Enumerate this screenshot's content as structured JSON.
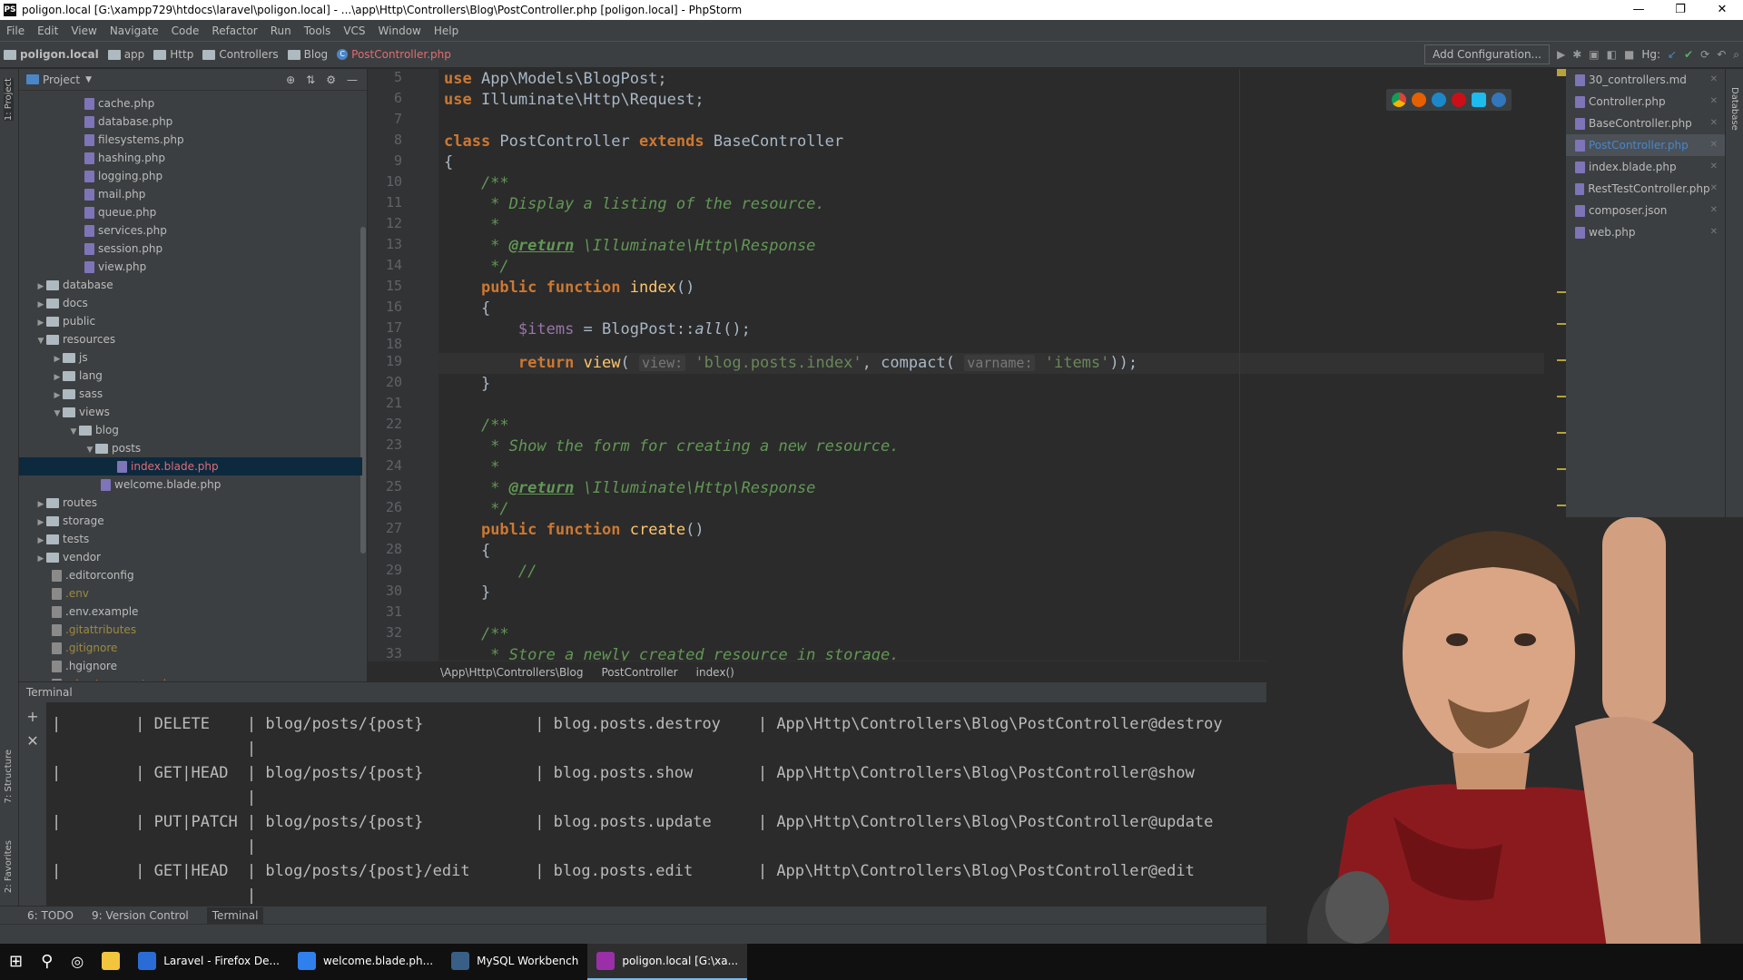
{
  "window": {
    "title": "poligon.local [G:\\xampp729\\htdocs\\laravel\\poligon.local] - ...\\app\\Http\\Controllers\\Blog\\PostController.php [poligon.local] - PhpStorm",
    "minimize": "—",
    "restore": "❐",
    "close": "✕"
  },
  "menu": [
    "File",
    "Edit",
    "View",
    "Navigate",
    "Code",
    "Refactor",
    "Run",
    "Tools",
    "VCS",
    "Window",
    "Help"
  ],
  "breadcrumbs": [
    "poligon.local",
    "app",
    "Http",
    "Controllers",
    "Blog",
    "PostController.php"
  ],
  "toolbar": {
    "add_configuration": "Add Configuration...",
    "hg_label": "Hg:"
  },
  "project_panel": {
    "title": "Project",
    "items": [
      {
        "label": "cache.php",
        "type": "file",
        "indent": 4
      },
      {
        "label": "database.php",
        "type": "file",
        "indent": 4
      },
      {
        "label": "filesystems.php",
        "type": "file",
        "indent": 4
      },
      {
        "label": "hashing.php",
        "type": "file",
        "indent": 4
      },
      {
        "label": "logging.php",
        "type": "file",
        "indent": 4
      },
      {
        "label": "mail.php",
        "type": "file",
        "indent": 4
      },
      {
        "label": "queue.php",
        "type": "file",
        "indent": 4
      },
      {
        "label": "services.php",
        "type": "file",
        "indent": 4
      },
      {
        "label": "session.php",
        "type": "file",
        "indent": 4
      },
      {
        "label": "view.php",
        "type": "file",
        "indent": 4
      },
      {
        "label": "database",
        "type": "folder",
        "indent": 1,
        "collapsed": true
      },
      {
        "label": "docs",
        "type": "folder",
        "indent": 1,
        "collapsed": true
      },
      {
        "label": "public",
        "type": "folder",
        "indent": 1,
        "collapsed": true
      },
      {
        "label": "resources",
        "type": "folder",
        "indent": 1,
        "collapsed": false
      },
      {
        "label": "js",
        "type": "folder",
        "indent": 2,
        "collapsed": true
      },
      {
        "label": "lang",
        "type": "folder",
        "indent": 2,
        "collapsed": true
      },
      {
        "label": "sass",
        "type": "folder",
        "indent": 2,
        "collapsed": true
      },
      {
        "label": "views",
        "type": "folder",
        "indent": 2,
        "collapsed": false
      },
      {
        "label": "blog",
        "type": "folder",
        "indent": 3,
        "collapsed": false
      },
      {
        "label": "posts",
        "type": "folder",
        "indent": 4,
        "collapsed": false
      },
      {
        "label": "index.blade.php",
        "type": "file",
        "indent": 6,
        "selected": true
      },
      {
        "label": "welcome.blade.php",
        "type": "file",
        "indent": 5
      },
      {
        "label": "routes",
        "type": "folder",
        "indent": 1,
        "collapsed": true
      },
      {
        "label": "storage",
        "type": "folder",
        "indent": 1,
        "collapsed": true
      },
      {
        "label": "tests",
        "type": "folder",
        "indent": 1,
        "collapsed": true
      },
      {
        "label": "vendor",
        "type": "folder",
        "indent": 1,
        "collapsed": true
      },
      {
        "label": ".editorconfig",
        "type": "file",
        "indent": 2
      },
      {
        "label": ".env",
        "type": "file",
        "indent": 2,
        "color": "gold"
      },
      {
        "label": ".env.example",
        "type": "file",
        "indent": 2
      },
      {
        "label": ".gitattributes",
        "type": "file",
        "indent": 2,
        "color": "gold"
      },
      {
        "label": ".gitignore",
        "type": "file",
        "indent": 2,
        "color": "gold"
      },
      {
        "label": ".hgignore",
        "type": "file",
        "indent": 2
      },
      {
        "label": ".phpstorm.meta.php",
        "type": "file",
        "indent": 2,
        "color": "orange"
      }
    ]
  },
  "editor": {
    "line_numbers": [
      "5",
      "6",
      "7",
      "8",
      "9",
      "10",
      "11",
      "12",
      "13",
      "14",
      "15",
      "16",
      "17",
      "18",
      "19",
      "20",
      "21",
      "22",
      "23",
      "24",
      "25",
      "26",
      "27",
      "28",
      "29",
      "30",
      "31",
      "32",
      "33"
    ],
    "breadcrumb": [
      "\\App\\Http\\Controllers\\Blog",
      "PostController",
      "index()"
    ]
  },
  "open_tabs": [
    {
      "label": "30_controllers.md"
    },
    {
      "label": "Controller.php"
    },
    {
      "label": "BaseController.php"
    },
    {
      "label": "PostController.php",
      "active": true
    },
    {
      "label": "index.blade.php"
    },
    {
      "label": "RestTestController.php"
    },
    {
      "label": "composer.json"
    },
    {
      "label": "web.php"
    }
  ],
  "terminal": {
    "title": "Terminal",
    "lines": [
      "|        | DELETE    | blog/posts/{post}            | blog.posts.destroy    | App\\Http\\Controllers\\Blog\\PostController@destroy",
      "                     |",
      "|        | GET|HEAD  | blog/posts/{post}            | blog.posts.show       | App\\Http\\Controllers\\Blog\\PostController@show",
      "                     |",
      "|        | PUT|PATCH | blog/posts/{post}            | blog.posts.update     | App\\Http\\Controllers\\Blog\\PostController@update",
      "                     |",
      "|        | GET|HEAD  | blog/posts/{post}/edit       | blog.posts.edit       | App\\Http\\Controllers\\Blog\\PostController@edit",
      "                     |"
    ]
  },
  "tool_windows": {
    "todo": "6: TODO",
    "version_control": "9: Version Control",
    "terminal": "Terminal",
    "project": "1: Project",
    "structure": "7: Structure",
    "favorites": "2: Favorites",
    "database": "Database"
  },
  "taskbar": [
    {
      "label": "Laravel - Firefox De...",
      "color": "#2a6cd6"
    },
    {
      "label": "welcome.blade.ph...",
      "color": "#2f80ed"
    },
    {
      "label": "MySQL Workbench",
      "color": "#3a5f86"
    },
    {
      "label": "poligon.local [G:\\xa...",
      "color": "#9b2fa8",
      "active": true
    }
  ],
  "colors": {
    "keyword": "#cc7832",
    "comment": "#629755",
    "string": "#6a8759",
    "variable": "#9876aa",
    "function": "#ffc66d",
    "selection": "#0d293e"
  }
}
